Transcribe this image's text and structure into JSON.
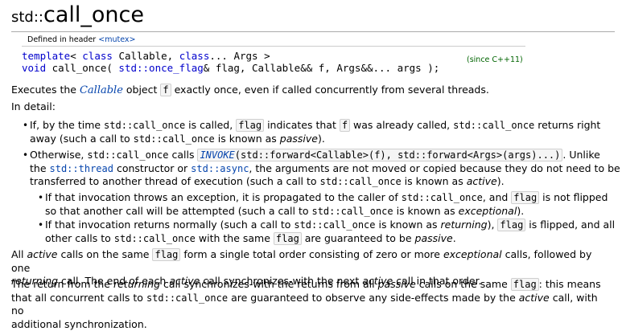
{
  "title": {
    "ns": "std::",
    "name": "call_once"
  },
  "decl": {
    "defined_in": "Defined in header",
    "header": "<mutex>",
    "line1": {
      "kw1": "template",
      "a": "< ",
      "kw2": "class",
      "b": " Callable, ",
      "kw3": "class",
      "c": "... Args >"
    },
    "line2": {
      "kw": "void",
      "a": " call_once( ",
      "t1": "std::once_flag",
      "b": "& flag, Callable&& f, Args&&... args );"
    },
    "since": "(since C++11)"
  },
  "p1": {
    "a": "Executes the ",
    "link": "Callable",
    "b": " object ",
    "f": "f",
    "c": " exactly once, even if called concurrently from several threads."
  },
  "p2": "In detail:",
  "b1": {
    "a": "If, by the time ",
    "c1": "std::call_once",
    "b": " is called, ",
    "flag": "flag",
    "c": " indicates that ",
    "f": "f",
    "d": " was already called, ",
    "c2": "std::call_once",
    "e": " returns right",
    "g": "away (such a call to ",
    "c3": "std::call_once",
    "h": " is known as ",
    "passive": "passive",
    "i": ")."
  },
  "b2": {
    "a": "Otherwise, ",
    "c1": "std::call_once",
    "b": " calls ",
    "invoke": "INVOKE",
    "args": "(std::forward<Callable>(f), std::forward<Args>(args)...)",
    "c": ". Unlike",
    "d": "the ",
    "thread": "std::thread",
    "e": " constructor or ",
    "async": "std::async",
    "g": ", the arguments are not moved or copied because they do not need to be",
    "h": "transferred to another thread of execution (such a call to ",
    "c2": "std::call_once",
    "i": " is known as ",
    "active": "active",
    "j": ")."
  },
  "b3": {
    "a": "If that invocation throws an exception, it is propagated to the caller of ",
    "c1": "std::call_once",
    "b": ", and ",
    "flag": "flag",
    "c": " is not flipped",
    "d": "so that another call will be attempted (such a call to ",
    "c2": "std::call_once",
    "e": " is known as ",
    "exceptional": "exceptional",
    "g": ")."
  },
  "b4": {
    "a": "If that invocation returns normally (such a call to ",
    "c1": "std::call_once",
    "b": " is known as ",
    "returning": "returning",
    "c": "), ",
    "flag": "flag",
    "d": " is flipped, and all",
    "e": "other calls to ",
    "c2": "std::call_once",
    "g": " with the same ",
    "flag2": "flag",
    "h": " are guaranteed to be ",
    "passive": "passive",
    "i": "."
  },
  "p3": {
    "a": "All ",
    "active": "active",
    "b": " calls on the same ",
    "flag": "flag",
    "c": " form a single total order consisting of zero or more ",
    "exceptional": "exceptional",
    "d": " calls, followed by one",
    "returning": "returning",
    "e": " call. The end of each ",
    "active2": "active",
    "g": " call synchronizes-with the next ",
    "active3": "active",
    "h": " call in that order."
  },
  "p4": {
    "a": "The return from the ",
    "returning": "returning",
    "b": " call synchronizes-with the returns from all ",
    "passive": "passive",
    "c": " calls on the same ",
    "flag": "flag",
    "d": ": this means",
    "e": "that all concurrent calls to ",
    "c1": "std::call_once",
    "g": " are guaranteed to observe any side-effects made by the ",
    "active": "active",
    "h": " call, with no",
    "i": "additional synchronization."
  }
}
